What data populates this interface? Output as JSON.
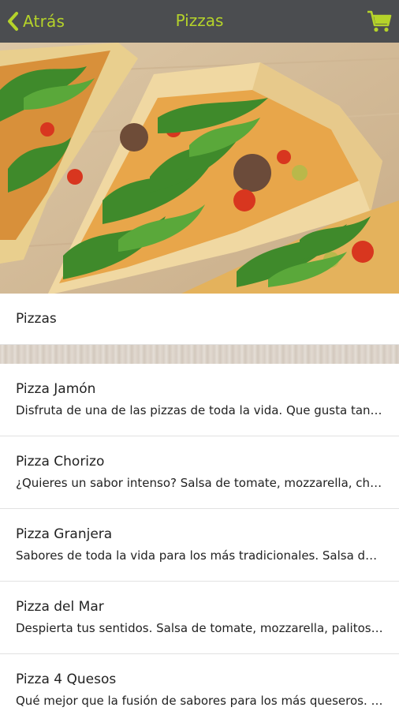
{
  "header": {
    "back_label": "Atrás",
    "title": "Pizzas",
    "accent_color": "#b5d32a",
    "bar_color": "#4b4d50",
    "back_icon": "chevron-left-icon",
    "cart_icon": "shopping-cart-icon"
  },
  "hero": {
    "subject": "pizza-photo"
  },
  "category": {
    "label": "Pizzas"
  },
  "items": [
    {
      "name": "Pizza Jamón",
      "description": "Disfruta de una de las pizzas de toda la vida. Que gusta tanto a grandes como a pequeños."
    },
    {
      "name": "Pizza Chorizo",
      "description": "¿Quieres un sabor intenso? Salsa de tomate, mozzarella, chorizo y orégano."
    },
    {
      "name": "Pizza Granjera",
      "description": "Sabores de toda la vida para los más tradicionales. Salsa de tomate, mozzarella, pollo y bacon."
    },
    {
      "name": "Pizza del Mar",
      "description": "Despierta tus sentidos. Salsa de tomate, mozzarella, palitos de cangrejo, gambas y atún."
    },
    {
      "name": "Pizza 4 Quesos",
      "description": "Qué mejor que la fusión de sabores para los más queseros. Mozzarella, gorgonzola, emmental y parmesano."
    }
  ]
}
